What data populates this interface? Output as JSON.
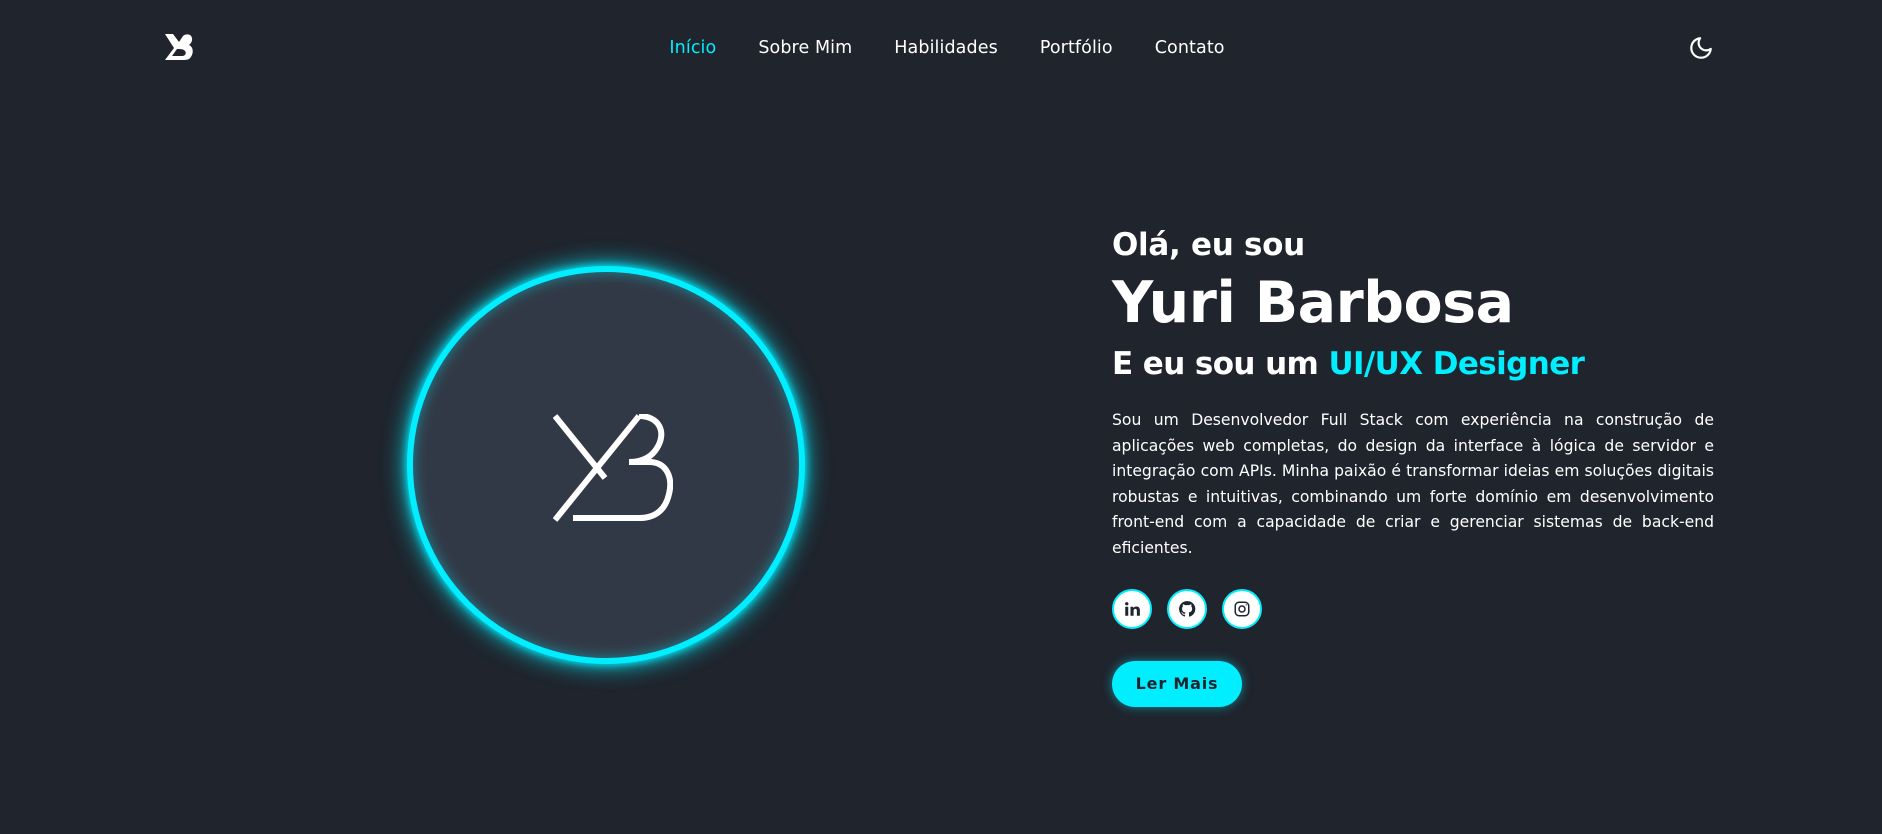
{
  "colors": {
    "accent": "#00eeff",
    "background": "#1f242d",
    "avatar_background": "#323946",
    "text": "#ffffff"
  },
  "header": {
    "logo_icon": "yb-logo-icon",
    "nav": [
      {
        "label": "Início",
        "active": true
      },
      {
        "label": "Sobre Mim",
        "active": false
      },
      {
        "label": "Habilidades",
        "active": false
      },
      {
        "label": "Portfólio",
        "active": false
      },
      {
        "label": "Contato",
        "active": false
      }
    ],
    "theme_toggle_icon": "moon-icon"
  },
  "hero": {
    "avatar_icon": "yb-monogram-icon",
    "greeting": "Olá, eu sou",
    "name": "Yuri Barbosa",
    "role_prefix": "E eu sou um ",
    "role_highlight": "UI/UX Designer",
    "bio": "Sou um Desenvolvedor Full Stack com experiência na construção de aplicações web completas, do design da interface à lógica de servidor e integração com APIs. Minha paixão é transformar ideias em soluções digitais robustas e intuitivas, combinando um forte domínio em desenvolvimento front-end com a capacidade de criar e gerenciar sistemas de back-end eficientes.",
    "socials": [
      {
        "icon": "linkedin-icon"
      },
      {
        "icon": "github-icon"
      },
      {
        "icon": "instagram-icon"
      }
    ],
    "cta_label": "Ler Mais"
  }
}
